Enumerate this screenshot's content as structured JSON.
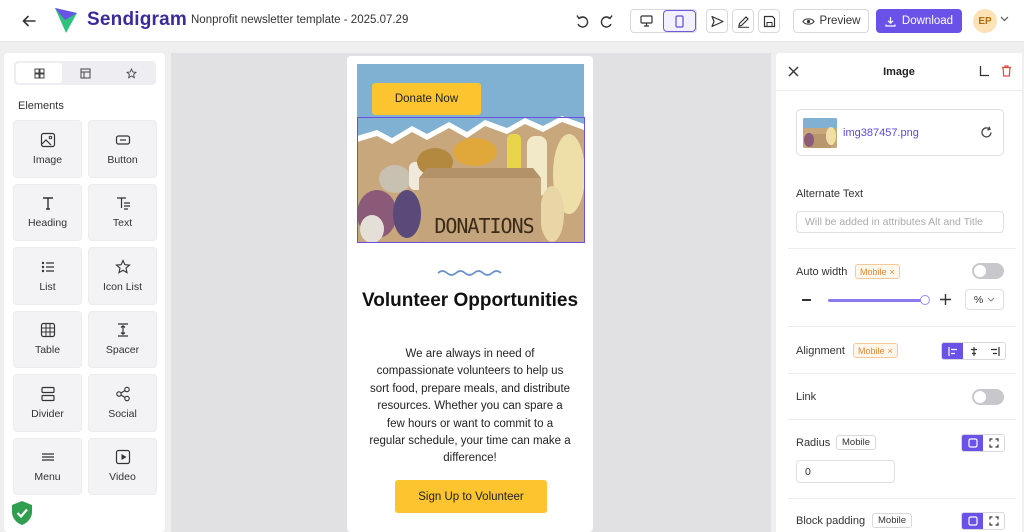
{
  "app": {
    "brand": "Sendigram",
    "document_title": "Nonprofit newsletter template - 2025.07.29"
  },
  "toolbar": {
    "preview_label": "Preview",
    "download_label": "Download",
    "avatar_initials": "EP"
  },
  "sidebar": {
    "section_title": "Elements",
    "elements": [
      {
        "label": "Image",
        "icon": "image-icon"
      },
      {
        "label": "Button",
        "icon": "button-icon"
      },
      {
        "label": "Heading",
        "icon": "heading-icon"
      },
      {
        "label": "Text",
        "icon": "text-icon"
      },
      {
        "label": "List",
        "icon": "list-icon"
      },
      {
        "label": "Icon List",
        "icon": "star-icon"
      },
      {
        "label": "Table",
        "icon": "table-icon"
      },
      {
        "label": "Spacer",
        "icon": "spacer-icon"
      },
      {
        "label": "Divider",
        "icon": "divider-icon"
      },
      {
        "label": "Social",
        "icon": "share-icon"
      },
      {
        "label": "Menu",
        "icon": "menu-icon"
      },
      {
        "label": "Video",
        "icon": "video-icon"
      }
    ]
  },
  "email": {
    "donate_button": "Donate Now",
    "hero_sign_text": "DONATIONS",
    "headline": "Volunteer Opportunities",
    "body": "We are always in need of compassionate volunteers to help us sort food, prepare meals, and distribute resources. Whether you can spare a few hours or want to commit to a regular schedule, your time can make a difference!",
    "cta_button": "Sign Up to Volunteer"
  },
  "inspector": {
    "title": "Image",
    "file_name": "img387457.png",
    "alt_text_label": "Alternate Text",
    "alt_text_placeholder": "Will be added in attributes Alt and Title",
    "auto_width_label": "Auto width",
    "mobile_tag": "Mobile",
    "unit": "%",
    "alignment_label": "Alignment",
    "link_label": "Link",
    "radius_label": "Radius",
    "radius_value": "0",
    "block_padding_label": "Block padding",
    "auto_width_slider_fraction": 0.97
  },
  "colors": {
    "accent": "#6a52e8",
    "brand": "#3b2a9a",
    "cta_yellow": "#fcc52f"
  }
}
